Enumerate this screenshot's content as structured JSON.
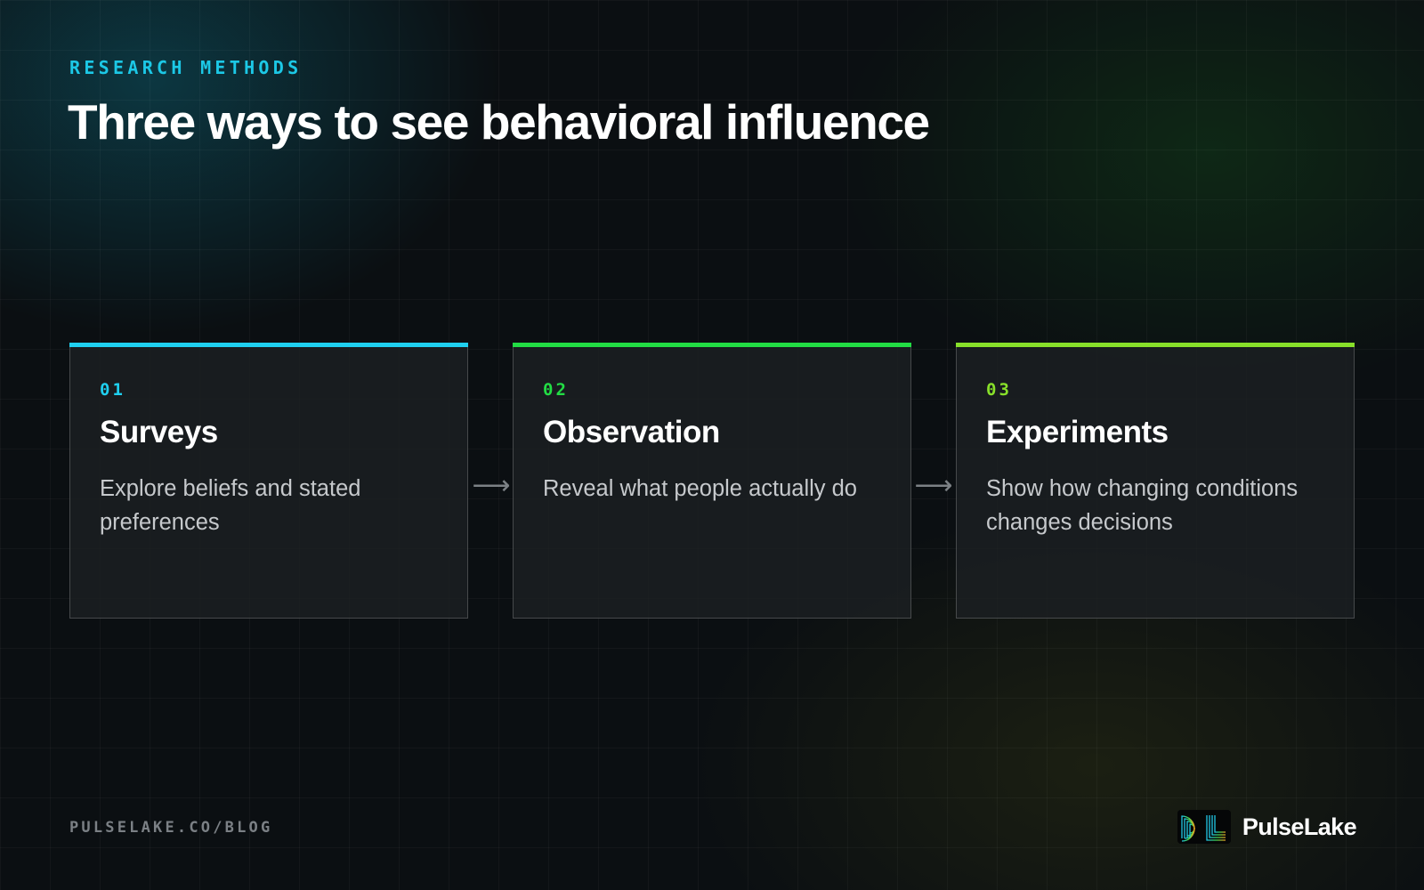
{
  "header": {
    "eyebrow": "RESEARCH METHODS",
    "title": "Three ways to see behavioral influence"
  },
  "cards": [
    {
      "number": "01",
      "title": "Surveys",
      "description": "Explore beliefs and stated preferences",
      "accent_color": "#1fd0f0"
    },
    {
      "number": "02",
      "title": "Observation",
      "description": "Reveal what people actually do",
      "accent_color": "#22dd44"
    },
    {
      "number": "03",
      "title": "Experiments",
      "description": "Show how changing conditions changes decisions",
      "accent_color": "#88e02a"
    }
  ],
  "connector_arrow": "⟶",
  "footer": {
    "url": "PULSELAKE.CO/BLOG",
    "brand_name": "PulseLake",
    "logo_text": "PL"
  },
  "colors": {
    "background": "#0b0f12",
    "eyebrow": "#1cc8e6",
    "card_text": "#c6c9cc",
    "footer_text": "#7b8085"
  }
}
